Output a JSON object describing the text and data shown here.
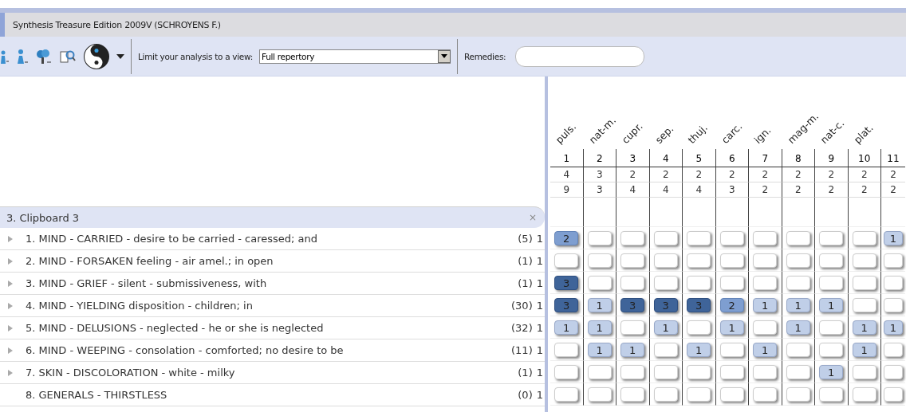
{
  "window": {
    "title": "Synthesis Treasure Edition 2009V (SCHROYENS F.)"
  },
  "toolbar": {
    "view_label": "Limit your analysis to a view:",
    "view_value": "Full repertory",
    "remedies_label": "Remedies:"
  },
  "clipboard": {
    "title": "3. Clipboard 3",
    "close": "×"
  },
  "remedies": [
    {
      "name": "puls.",
      "number": "1",
      "count": "4",
      "score": "9"
    },
    {
      "name": "nat-m.",
      "number": "2",
      "count": "3",
      "score": "3"
    },
    {
      "name": "cupr.",
      "number": "3",
      "count": "2",
      "score": "4"
    },
    {
      "name": "sep.",
      "number": "4",
      "count": "2",
      "score": "4"
    },
    {
      "name": "thuj.",
      "number": "5",
      "count": "2",
      "score": "4"
    },
    {
      "name": "carc.",
      "number": "6",
      "count": "2",
      "score": "3"
    },
    {
      "name": "ign.",
      "number": "7",
      "count": "2",
      "score": "2"
    },
    {
      "name": "mag-m.",
      "number": "8",
      "count": "2",
      "score": "2"
    },
    {
      "name": "nat-c.",
      "number": "9",
      "count": "2",
      "score": "2"
    },
    {
      "name": "plat.",
      "number": "10",
      "count": "2",
      "score": "2"
    },
    {
      "number": "11",
      "count": "2",
      "score": "2"
    }
  ],
  "rows": [
    {
      "text": "1. MIND - CARRIED - desire to be carried - caressed; and",
      "count": "(5)",
      "weight": "1",
      "expandable": true,
      "cells": [
        {
          "filled": true,
          "grade": "2"
        },
        {
          "filled": false
        },
        {
          "filled": false
        },
        {
          "filled": false
        },
        {
          "filled": false
        },
        {
          "filled": false
        },
        {
          "filled": false
        },
        {
          "filled": false
        },
        {
          "filled": false
        },
        {
          "filled": false
        },
        {
          "filled": true,
          "grade": "1"
        }
      ]
    },
    {
      "text": "2. MIND - FORSAKEN feeling - air amel.; in open",
      "count": "(1)",
      "weight": "1",
      "expandable": true,
      "cells": [
        {
          "filled": false
        },
        {
          "filled": false
        },
        {
          "filled": false
        },
        {
          "filled": false
        },
        {
          "filled": false
        },
        {
          "filled": false
        },
        {
          "filled": false
        },
        {
          "filled": false
        },
        {
          "filled": false
        },
        {
          "filled": false
        },
        {
          "filled": false
        }
      ]
    },
    {
      "text": "3. MIND - GRIEF - silent - submissiveness, with",
      "count": "(1)",
      "weight": "1",
      "expandable": true,
      "cells": [
        {
          "filled": true,
          "grade": "3"
        },
        {
          "filled": false
        },
        {
          "filled": false
        },
        {
          "filled": false
        },
        {
          "filled": false
        },
        {
          "filled": false
        },
        {
          "filled": false
        },
        {
          "filled": false
        },
        {
          "filled": false
        },
        {
          "filled": false
        },
        {
          "filled": false
        }
      ]
    },
    {
      "text": "4. MIND - YIELDING disposition - children; in",
      "count": "(30)",
      "weight": "1",
      "expandable": true,
      "cells": [
        {
          "filled": true,
          "grade": "3"
        },
        {
          "filled": true,
          "grade": "1"
        },
        {
          "filled": true,
          "grade": "3"
        },
        {
          "filled": true,
          "grade": "3"
        },
        {
          "filled": true,
          "grade": "3"
        },
        {
          "filled": true,
          "grade": "2"
        },
        {
          "filled": true,
          "grade": "1"
        },
        {
          "filled": true,
          "grade": "1"
        },
        {
          "filled": true,
          "grade": "1"
        },
        {
          "filled": false
        },
        {
          "filled": false
        }
      ]
    },
    {
      "text": "5. MIND - DELUSIONS - neglected - he or she is neglected",
      "count": "(32)",
      "weight": "1",
      "expandable": true,
      "cells": [
        {
          "filled": true,
          "grade": "1"
        },
        {
          "filled": true,
          "grade": "1"
        },
        {
          "filled": false
        },
        {
          "filled": true,
          "grade": "1"
        },
        {
          "filled": false
        },
        {
          "filled": true,
          "grade": "1"
        },
        {
          "filled": false
        },
        {
          "filled": true,
          "grade": "1"
        },
        {
          "filled": false
        },
        {
          "filled": true,
          "grade": "1"
        },
        {
          "filled": true,
          "grade": "1"
        }
      ]
    },
    {
      "text": "6. MIND - WEEPING - consolation - comforted; no desire to be",
      "count": "(11)",
      "weight": "1",
      "expandable": true,
      "cells": [
        {
          "filled": false
        },
        {
          "filled": true,
          "grade": "1"
        },
        {
          "filled": true,
          "grade": "1"
        },
        {
          "filled": false
        },
        {
          "filled": true,
          "grade": "1"
        },
        {
          "filled": false
        },
        {
          "filled": true,
          "grade": "1"
        },
        {
          "filled": false
        },
        {
          "filled": false
        },
        {
          "filled": true,
          "grade": "1"
        },
        {
          "filled": false
        }
      ]
    },
    {
      "text": "7. SKIN - DISCOLORATION - white - milky",
      "count": "(1)",
      "weight": "1",
      "expandable": true,
      "cells": [
        {
          "filled": false
        },
        {
          "filled": false
        },
        {
          "filled": false
        },
        {
          "filled": false
        },
        {
          "filled": false
        },
        {
          "filled": false
        },
        {
          "filled": false
        },
        {
          "filled": false
        },
        {
          "filled": true,
          "grade": "1"
        },
        {
          "filled": false
        },
        {
          "filled": false
        }
      ]
    },
    {
      "text": "8. GENERALS - THIRSTLESS",
      "count": "(0)",
      "weight": "1",
      "expandable": false,
      "cells": [
        {
          "filled": false
        },
        {
          "filled": false
        },
        {
          "filled": false
        },
        {
          "filled": false
        },
        {
          "filled": false
        },
        {
          "filled": false
        },
        {
          "filled": false
        },
        {
          "filled": false
        },
        {
          "filled": false
        },
        {
          "filled": false
        },
        {
          "filled": false
        }
      ]
    }
  ]
}
